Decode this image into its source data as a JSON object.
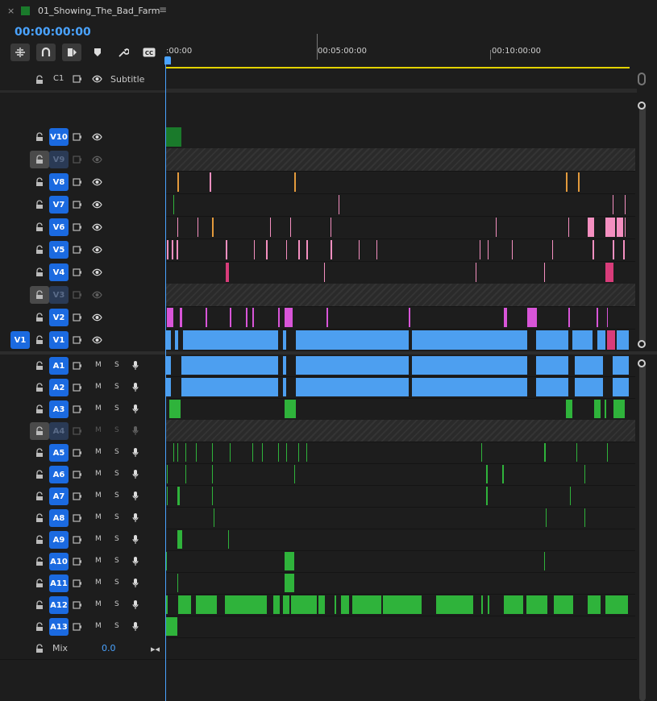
{
  "window": {
    "tab_title": "01_Showing_The_Bad_Farm",
    "close_glyph": "×",
    "menu_glyph": "≡",
    "sequence_color": "#1a7a2b"
  },
  "timeline": {
    "timecode": "00:00:00:00",
    "ruler_labels": [
      ":00:00",
      "00:05:00:00",
      "00:10:00:00"
    ],
    "mix_label": "Mix",
    "mix_value": "0.0",
    "subtitle_track_label": "C1",
    "subtitle_label": "Subtitle",
    "source_patch_label": "V1"
  },
  "toolbar_icons": [
    "nest-sequence-icon",
    "snap-magnet-icon",
    "linked-selection-icon",
    "add-marker-icon",
    "settings-wrench-icon",
    "captions-icon"
  ],
  "colors": {
    "accent": "#4aa3ff",
    "badge": "#1b6ae0",
    "video_clip": "#4d9ff0",
    "audio_clip": "#2fb33b",
    "pink_clip": "#f48fc0",
    "magenta_clip": "#d855d8",
    "orange_clip": "#e39a3c",
    "rose_clip": "#d83c7a",
    "green_graphic": "#1a7a2b",
    "workarea": "#e3d200"
  },
  "video_tracks": [
    {
      "label": "V10",
      "locked": false
    },
    {
      "label": "V9",
      "locked": true
    },
    {
      "label": "V8",
      "locked": false
    },
    {
      "label": "V7",
      "locked": false
    },
    {
      "label": "V6",
      "locked": false
    },
    {
      "label": "V5",
      "locked": false
    },
    {
      "label": "V4",
      "locked": false
    },
    {
      "label": "V3",
      "locked": true
    },
    {
      "label": "V2",
      "locked": false
    },
    {
      "label": "V1",
      "locked": false
    }
  ],
  "audio_tracks": [
    {
      "label": "A1",
      "locked": false,
      "m": "M",
      "s": "S"
    },
    {
      "label": "A2",
      "locked": false,
      "m": "M",
      "s": "S"
    },
    {
      "label": "A3",
      "locked": false,
      "m": "M",
      "s": "S"
    },
    {
      "label": "A4",
      "locked": true,
      "m": "M",
      "s": "S"
    },
    {
      "label": "A5",
      "locked": false,
      "m": "M",
      "s": "S"
    },
    {
      "label": "A6",
      "locked": false,
      "m": "M",
      "s": "S"
    },
    {
      "label": "A7",
      "locked": false,
      "m": "M",
      "s": "S"
    },
    {
      "label": "A8",
      "locked": false,
      "m": "M",
      "s": "S"
    },
    {
      "label": "A9",
      "locked": false,
      "m": "M",
      "s": "S"
    },
    {
      "label": "A10",
      "locked": false,
      "m": "M",
      "s": "S"
    },
    {
      "label": "A11",
      "locked": false,
      "m": "M",
      "s": "S"
    },
    {
      "label": "A12",
      "locked": false,
      "m": "M",
      "s": "S"
    },
    {
      "label": "A13",
      "locked": false,
      "m": "M",
      "s": "S"
    }
  ]
}
